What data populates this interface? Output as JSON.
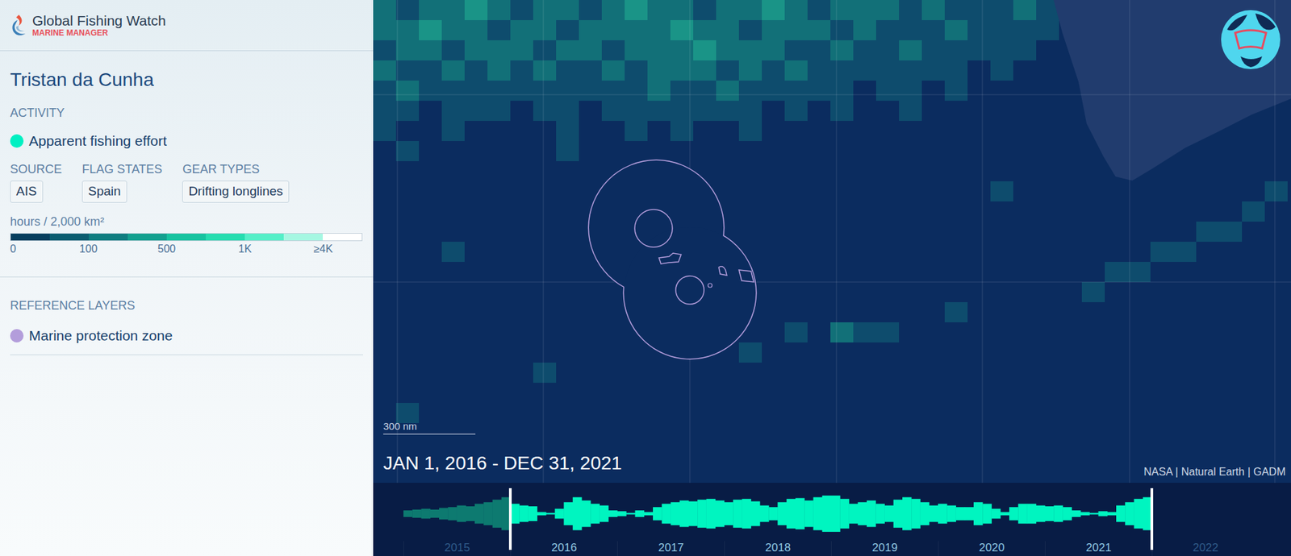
{
  "app": {
    "title": "Global Fishing Watch",
    "subtitle": "MARINE MANAGER"
  },
  "area": {
    "title": "Tristan da Cunha"
  },
  "activity": {
    "heading": "ACTIVITY",
    "layer": {
      "label": "Apparent fishing effort",
      "color": "#00f0c2"
    },
    "filters": [
      {
        "label": "SOURCE",
        "values": [
          "AIS"
        ]
      },
      {
        "label": "FLAG STATES",
        "values": [
          "Spain"
        ]
      },
      {
        "label": "GEAR TYPES",
        "values": [
          "Drifting longlines"
        ]
      }
    ],
    "legend": {
      "unit": "hours / 2,000 km²",
      "ticks": [
        "0",
        "100",
        "500",
        "1K",
        "≥4K"
      ]
    }
  },
  "reference_layers": {
    "heading": "REFERENCE LAYERS",
    "items": [
      {
        "label": "Marine protection zone",
        "color": "#b39ddb"
      }
    ]
  },
  "map": {
    "scale": "300 nm",
    "date_range": "JAN 1, 2016 - DEC 31, 2021",
    "attribution": "NASA | Natural Earth | GADM",
    "heat_grid": [
      [
        2,
        1,
        2,
        2,
        3,
        2,
        1,
        2,
        2,
        1,
        2,
        3,
        2,
        2,
        1,
        2,
        2,
        3,
        2,
        1,
        2,
        2,
        2,
        1,
        2,
        1,
        1,
        1,
        2,
        1
      ],
      [
        2,
        2,
        3,
        2,
        2,
        1,
        2,
        2,
        1,
        2,
        2,
        2,
        2,
        3,
        2,
        2,
        1,
        2,
        2,
        2,
        1,
        2,
        1,
        1,
        1,
        2,
        1,
        1,
        1,
        1
      ],
      [
        1,
        2,
        2,
        1,
        2,
        2,
        2,
        1,
        2,
        2,
        1,
        2,
        2,
        2,
        3,
        2,
        2,
        2,
        1,
        1,
        2,
        1,
        1,
        2,
        1,
        1,
        1,
        1,
        1,
        0
      ],
      [
        2,
        1,
        1,
        2,
        1,
        2,
        1,
        2,
        1,
        1,
        2,
        1,
        2,
        2,
        2,
        1,
        2,
        1,
        2,
        1,
        1,
        1,
        1,
        1,
        1,
        1,
        0,
        1,
        0,
        0
      ],
      [
        1,
        2,
        1,
        1,
        1,
        1,
        1,
        1,
        1,
        1,
        1,
        1,
        2,
        1,
        1,
        2,
        1,
        1,
        1,
        1,
        1,
        0,
        1,
        1,
        0,
        1,
        0,
        0,
        0,
        0
      ],
      [
        1,
        1,
        0,
        1,
        1,
        1,
        0,
        1,
        1,
        0,
        1,
        1,
        1,
        1,
        1,
        1,
        1,
        0,
        1,
        0,
        1,
        0,
        0,
        1,
        0,
        0,
        0,
        0,
        0,
        0
      ],
      [
        1,
        0,
        0,
        1,
        0,
        0,
        0,
        0,
        1,
        0,
        0,
        1,
        0,
        1,
        0,
        0,
        1,
        0,
        0,
        0,
        0,
        0,
        0,
        0,
        0,
        0,
        0,
        0,
        0,
        0
      ],
      [
        0,
        1,
        0,
        0,
        0,
        0,
        0,
        0,
        1,
        0,
        0,
        0,
        0,
        0,
        0,
        0,
        0,
        0,
        0,
        0,
        0,
        0,
        0,
        0,
        0,
        0,
        0,
        0,
        0,
        0
      ]
    ],
    "heat_cells": [
      [
        27,
        9,
        1
      ],
      [
        3,
        12,
        1
      ],
      [
        31,
        14,
        1
      ],
      [
        32,
        13,
        1
      ],
      [
        33,
        13,
        1
      ],
      [
        34,
        12,
        1
      ],
      [
        35,
        12,
        1
      ],
      [
        36,
        11,
        1
      ],
      [
        37,
        11,
        1
      ],
      [
        38,
        10,
        1
      ],
      [
        39,
        9,
        1
      ],
      [
        25,
        15,
        1
      ],
      [
        20,
        16,
        2
      ],
      [
        21,
        16,
        1
      ],
      [
        22,
        16,
        1
      ],
      [
        18,
        16,
        1
      ],
      [
        16,
        17,
        1
      ],
      [
        7,
        18,
        1
      ],
      [
        1,
        20,
        1
      ]
    ]
  },
  "timeline": {
    "years": [
      {
        "label": "2015",
        "selected": false
      },
      {
        "label": "2016",
        "selected": true
      },
      {
        "label": "2017",
        "selected": true
      },
      {
        "label": "2018",
        "selected": true
      },
      {
        "label": "2019",
        "selected": true
      },
      {
        "label": "2020",
        "selected": true
      },
      {
        "label": "2021",
        "selected": true
      },
      {
        "label": "2022",
        "selected": false
      }
    ],
    "monthly_effort": [
      4,
      5,
      6,
      5,
      7,
      8,
      10,
      9,
      12,
      14,
      17,
      20,
      12,
      10,
      9,
      2,
      1,
      6,
      14,
      20,
      16,
      12,
      10,
      4,
      3,
      1,
      4,
      2,
      8,
      12,
      14,
      16,
      15,
      17,
      18,
      16,
      14,
      17,
      18,
      15,
      10,
      8,
      14,
      18,
      19,
      16,
      20,
      22,
      22,
      18,
      12,
      14,
      16,
      12,
      10,
      17,
      20,
      18,
      14,
      10,
      12,
      10,
      8,
      8,
      14,
      12,
      6,
      2,
      8,
      12,
      12,
      10,
      9,
      10,
      8,
      4,
      2,
      1,
      3,
      2,
      10,
      14,
      18,
      20
    ]
  }
}
